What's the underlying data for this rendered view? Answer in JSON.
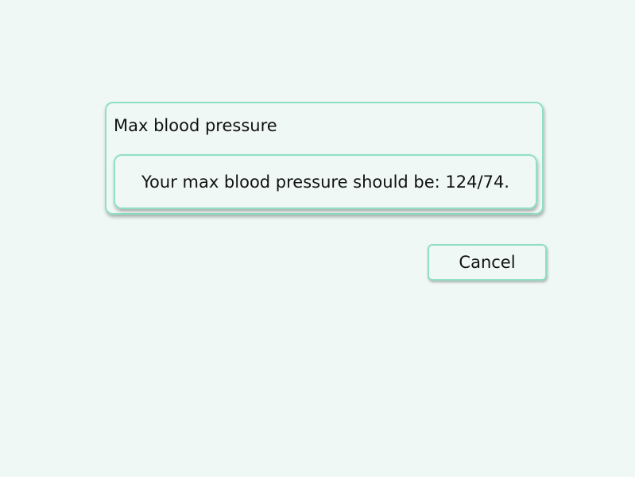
{
  "dialog": {
    "title": "Max blood pressure",
    "message": "Your max blood pressure should be: 124/74.",
    "cancel_label": "Cancel"
  },
  "colors": {
    "background": "#f0f8f6",
    "border": "#8fe0c4"
  }
}
